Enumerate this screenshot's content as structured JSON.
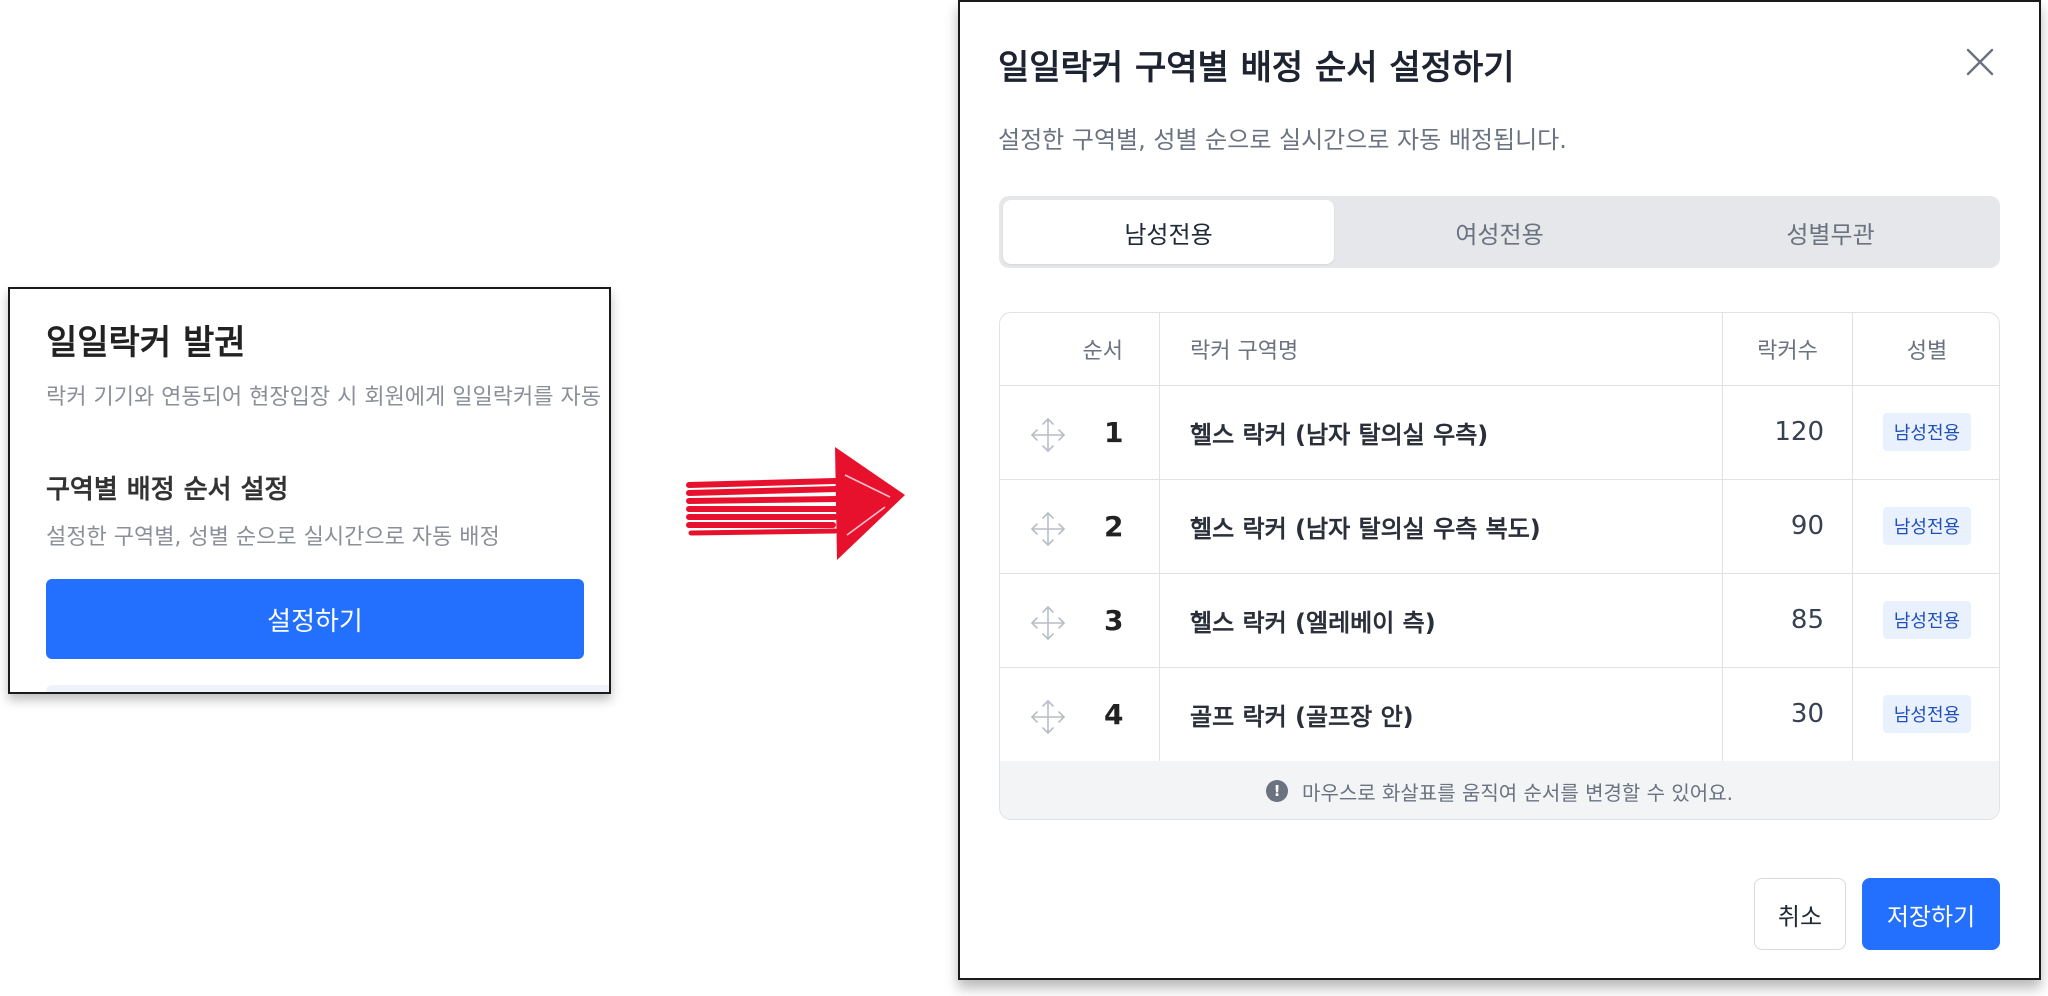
{
  "left_card": {
    "title": "일일락커 발권",
    "description": "락커 기기와 연동되어 현장입장 시 회원에게 일일락커를 자동",
    "section_title": "구역별 배정 순서 설정",
    "section_description": "설정한 구역별, 성별 순으로 실시간으로 자동 배정",
    "button_label": "설정하기",
    "button_color": "#2370ff"
  },
  "arrow": {
    "color": "#e8112d",
    "icon": "arrow-right-icon"
  },
  "modal": {
    "title": "일일락커 구역별 배정 순서 설정하기",
    "description": "설정한 구역별, 성별 순으로 실시간으로 자동 배정됩니다.",
    "tabs": [
      {
        "label": "남성전용",
        "active": true
      },
      {
        "label": "여성전용",
        "active": false
      },
      {
        "label": "성별무관",
        "active": false
      }
    ],
    "table": {
      "headers": {
        "order": "순서",
        "name": "락커 구역명",
        "count": "락커수",
        "gender": "성별"
      },
      "rows": [
        {
          "order": "1",
          "name": "헬스 락커 (남자 탈의실 우측)",
          "count": "120",
          "gender": "남성전용"
        },
        {
          "order": "2",
          "name": "헬스 락커 (남자 탈의실 우측 복도)",
          "count": "90",
          "gender": "남성전용"
        },
        {
          "order": "3",
          "name": "헬스 락커 (엘레베이 측)",
          "count": "85",
          "gender": "남성전용"
        },
        {
          "order": "4",
          "name": "골프 락커 (골프장 안)",
          "count": "30",
          "gender": "남성전용"
        }
      ],
      "footer_note": "마우스로 화살표를 움직여 순서를 변경할 수 있어요.",
      "footer_icon": "!"
    },
    "buttons": {
      "cancel": "취소",
      "save": "저장하기"
    }
  }
}
